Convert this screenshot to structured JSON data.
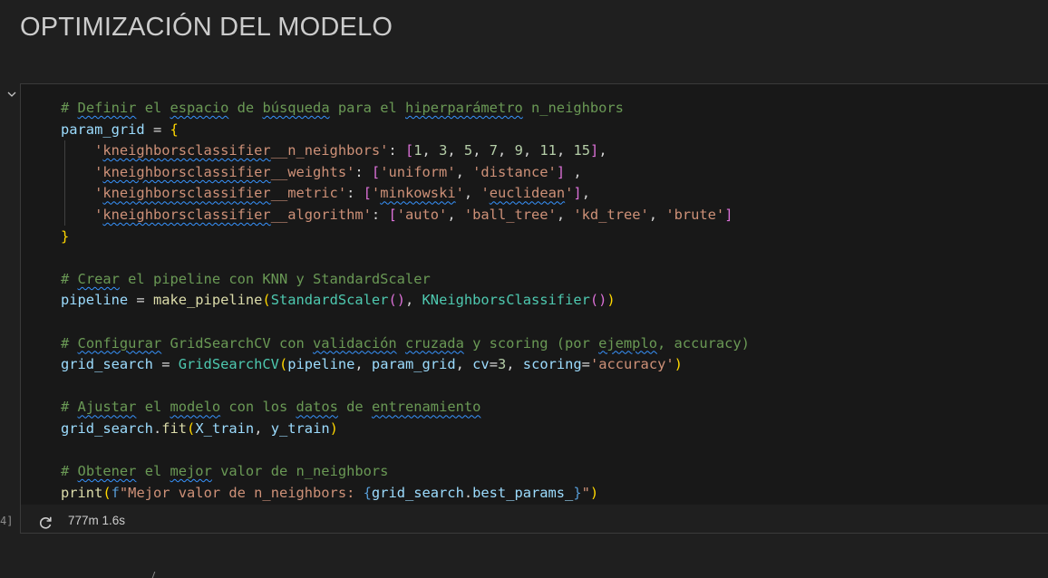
{
  "heading": "OPTIMIZACIÓN DEL MODELO",
  "cell": {
    "execution_count": "4]",
    "status": "777m 1.6s",
    "code": [
      [
        [
          "cm",
          "# "
        ],
        [
          "cm sq",
          "Definir"
        ],
        [
          "cm",
          " el "
        ],
        [
          "cm sq",
          "espacio"
        ],
        [
          "cm",
          " de "
        ],
        [
          "cm sq",
          "búsqueda"
        ],
        [
          "cm",
          " para el "
        ],
        [
          "cm sq",
          "hiperparámetro"
        ],
        [
          "cm",
          " n_neighbors"
        ]
      ],
      [
        [
          "var",
          "param_grid"
        ],
        [
          "op",
          " = "
        ],
        [
          "b1",
          "{"
        ]
      ],
      [
        [
          "op",
          "    "
        ],
        [
          "str",
          "'"
        ],
        [
          "str sq",
          "kneighborsclassifier"
        ],
        [
          "str",
          "__n_neighbors'"
        ],
        [
          "op",
          ": "
        ],
        [
          "b2",
          "["
        ],
        [
          "num",
          "1"
        ],
        [
          "op",
          ", "
        ],
        [
          "num",
          "3"
        ],
        [
          "op",
          ", "
        ],
        [
          "num",
          "5"
        ],
        [
          "op",
          ", "
        ],
        [
          "num",
          "7"
        ],
        [
          "op",
          ", "
        ],
        [
          "num",
          "9"
        ],
        [
          "op",
          ", "
        ],
        [
          "num",
          "11"
        ],
        [
          "op",
          ", "
        ],
        [
          "num",
          "15"
        ],
        [
          "b2",
          "]"
        ],
        [
          "op",
          ","
        ]
      ],
      [
        [
          "op",
          "    "
        ],
        [
          "str",
          "'"
        ],
        [
          "str sq",
          "kneighborsclassifier"
        ],
        [
          "str",
          "__weights'"
        ],
        [
          "op",
          ": "
        ],
        [
          "b2",
          "["
        ],
        [
          "str",
          "'uniform'"
        ],
        [
          "op",
          ", "
        ],
        [
          "str",
          "'distance'"
        ],
        [
          "b2",
          "]"
        ],
        [
          "op",
          " ,"
        ]
      ],
      [
        [
          "op",
          "    "
        ],
        [
          "str",
          "'"
        ],
        [
          "str sq",
          "kneighborsclassifier"
        ],
        [
          "str",
          "__metric'"
        ],
        [
          "op",
          ": "
        ],
        [
          "b2",
          "["
        ],
        [
          "str",
          "'"
        ],
        [
          "str sq",
          "minkowski"
        ],
        [
          "str",
          "'"
        ],
        [
          "op",
          ", "
        ],
        [
          "str",
          "'"
        ],
        [
          "str sq",
          "euclidean"
        ],
        [
          "str",
          "'"
        ],
        [
          "b2",
          "]"
        ],
        [
          "op",
          ","
        ]
      ],
      [
        [
          "op",
          "    "
        ],
        [
          "str",
          "'"
        ],
        [
          "str sq",
          "kneighborsclassifier"
        ],
        [
          "str",
          "__algorithm'"
        ],
        [
          "op",
          ": "
        ],
        [
          "b2",
          "["
        ],
        [
          "str",
          "'auto'"
        ],
        [
          "op",
          ", "
        ],
        [
          "str",
          "'ball_tree'"
        ],
        [
          "op",
          ", "
        ],
        [
          "str",
          "'kd_tree'"
        ],
        [
          "op",
          ", "
        ],
        [
          "str",
          "'brute'"
        ],
        [
          "b2",
          "]"
        ]
      ],
      [
        [
          "b1",
          "}"
        ]
      ],
      [],
      [
        [
          "cm",
          "# "
        ],
        [
          "cm sq",
          "Crear"
        ],
        [
          "cm",
          " el pipeline con KNN y StandardScaler"
        ]
      ],
      [
        [
          "var",
          "pipeline"
        ],
        [
          "op",
          " = "
        ],
        [
          "fn",
          "make_pipeline"
        ],
        [
          "b1",
          "("
        ],
        [
          "cls",
          "StandardScaler"
        ],
        [
          "b2",
          "()"
        ],
        [
          "op",
          ", "
        ],
        [
          "cls",
          "KNeighborsClassifier"
        ],
        [
          "b2",
          "()"
        ],
        [
          "b1",
          ")"
        ]
      ],
      [],
      [
        [
          "cm",
          "# "
        ],
        [
          "cm sq",
          "Configurar"
        ],
        [
          "cm",
          " GridSearchCV con "
        ],
        [
          "cm sq",
          "validación"
        ],
        [
          "cm",
          " "
        ],
        [
          "cm sq",
          "cruzada"
        ],
        [
          "cm",
          " y scoring (por "
        ],
        [
          "cm sq",
          "ejemplo"
        ],
        [
          "cm",
          ", accuracy)"
        ]
      ],
      [
        [
          "var",
          "grid_search"
        ],
        [
          "op",
          " = "
        ],
        [
          "cls",
          "GridSearchCV"
        ],
        [
          "b1",
          "("
        ],
        [
          "var",
          "pipeline"
        ],
        [
          "op",
          ", "
        ],
        [
          "var",
          "param_grid"
        ],
        [
          "op",
          ", "
        ],
        [
          "var",
          "cv"
        ],
        [
          "op",
          "="
        ],
        [
          "num",
          "3"
        ],
        [
          "op",
          ", "
        ],
        [
          "var",
          "scoring"
        ],
        [
          "op",
          "="
        ],
        [
          "str",
          "'accuracy'"
        ],
        [
          "b1",
          ")"
        ]
      ],
      [],
      [
        [
          "cm",
          "# "
        ],
        [
          "cm sq",
          "Ajustar"
        ],
        [
          "cm",
          " el "
        ],
        [
          "cm sq",
          "modelo"
        ],
        [
          "cm",
          " con los "
        ],
        [
          "cm sq",
          "datos"
        ],
        [
          "cm",
          " de "
        ],
        [
          "cm sq",
          "entrenamiento"
        ]
      ],
      [
        [
          "var",
          "grid_search"
        ],
        [
          "op",
          "."
        ],
        [
          "fn",
          "fit"
        ],
        [
          "b1",
          "("
        ],
        [
          "var",
          "X_train"
        ],
        [
          "op",
          ", "
        ],
        [
          "var",
          "y_train"
        ],
        [
          "b1",
          ")"
        ]
      ],
      [],
      [
        [
          "cm",
          "# "
        ],
        [
          "cm sq",
          "Obtener"
        ],
        [
          "cm",
          " el "
        ],
        [
          "cm sq",
          "mejor"
        ],
        [
          "cm",
          " valor de n_neighbors"
        ]
      ],
      [
        [
          "fn",
          "print"
        ],
        [
          "b1",
          "("
        ],
        [
          "kw",
          "f"
        ],
        [
          "str",
          "\"Mejor valor de n_neighbors: "
        ],
        [
          "kw",
          "{"
        ],
        [
          "var",
          "grid_search"
        ],
        [
          "op",
          "."
        ],
        [
          "var",
          "best_params_"
        ],
        [
          "kw",
          "}"
        ],
        [
          "str",
          "\""
        ],
        [
          "b1",
          ")"
        ]
      ]
    ]
  }
}
